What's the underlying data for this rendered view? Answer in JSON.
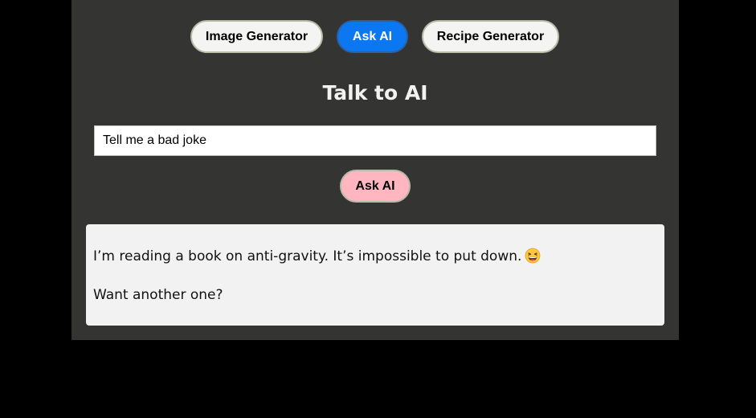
{
  "nav": {
    "items": [
      {
        "label": "Image Generator",
        "active": false
      },
      {
        "label": "Ask AI",
        "active": true
      },
      {
        "label": "Recipe Generator",
        "active": false
      }
    ]
  },
  "title": "Talk to AI",
  "prompt": {
    "value": "Tell me a bad joke",
    "placeholder": ""
  },
  "ask_button_label": "Ask AI",
  "response": {
    "line1": "I’m reading a book on anti-gravity. It’s impossible to put down.",
    "emoji_icon": "grinning-squinting-face-icon",
    "line2": "Want another one?"
  },
  "colors": {
    "panel_bg": "#343432",
    "page_bg": "#000000",
    "active_nav": "#0b78f2",
    "ask_button": "#ffb6c1",
    "response_bg": "#f2f2f2"
  }
}
